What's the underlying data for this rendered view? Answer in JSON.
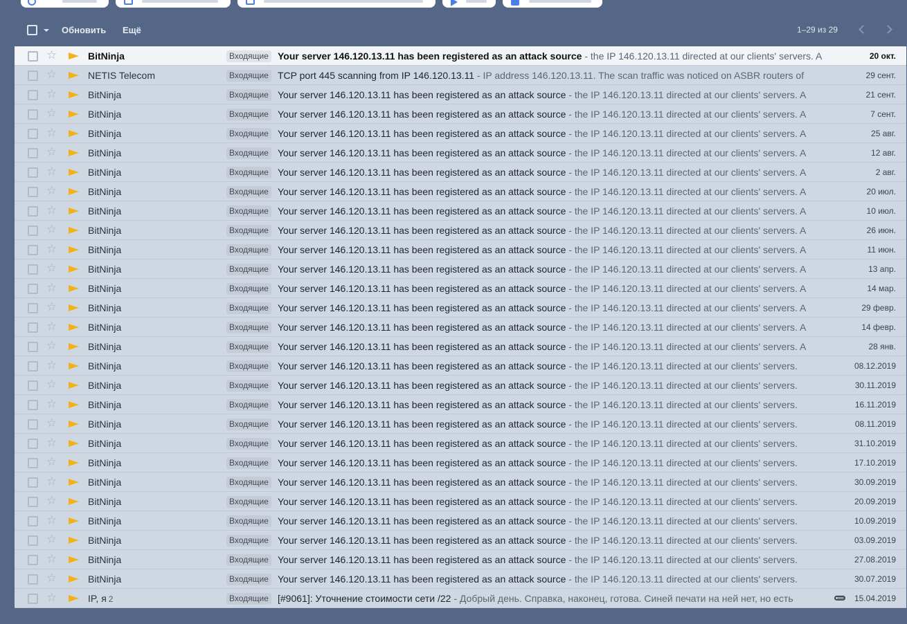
{
  "toolbar": {
    "refresh_label": "Обновить",
    "more_label": "Ещё",
    "pagination": "1–29 из 29"
  },
  "label_default": "Входящие",
  "emails": [
    {
      "sender": "BitNinja",
      "count": "",
      "label": "Входящие",
      "subject": "Your server 146.120.13.11 has been registered as an attack source",
      "snippet": " - the IP 146.120.13.11 directed at our clients' servers. A",
      "date": "20 окт.",
      "unread": true,
      "attachment": false
    },
    {
      "sender": "NETIS Telecom",
      "count": "",
      "label": "Входящие",
      "subject": "TCP port 445 scanning from IP 146.120.13.11",
      "snippet": " - IP address 146.120.13.11. The scan traffic was noticed on ASBR routers of",
      "date": "29 сент.",
      "unread": false,
      "attachment": false
    },
    {
      "sender": "BitNinja",
      "count": "",
      "label": "Входящие",
      "subject": "Your server 146.120.13.11 has been registered as an attack source",
      "snippet": " - the IP 146.120.13.11 directed at our clients' servers. A",
      "date": "21 сент.",
      "unread": false,
      "attachment": false
    },
    {
      "sender": "BitNinja",
      "count": "",
      "label": "Входящие",
      "subject": "Your server 146.120.13.11 has been registered as an attack source",
      "snippet": " - the IP 146.120.13.11 directed at our clients' servers. A",
      "date": "7 сент.",
      "unread": false,
      "attachment": false
    },
    {
      "sender": "BitNinja",
      "count": "",
      "label": "Входящие",
      "subject": "Your server 146.120.13.11 has been registered as an attack source",
      "snippet": " - the IP 146.120.13.11 directed at our clients' servers. A",
      "date": "25 авг.",
      "unread": false,
      "attachment": false
    },
    {
      "sender": "BitNinja",
      "count": "",
      "label": "Входящие",
      "subject": "Your server 146.120.13.11 has been registered as an attack source",
      "snippet": " - the IP 146.120.13.11 directed at our clients' servers. A",
      "date": "12 авг.",
      "unread": false,
      "attachment": false
    },
    {
      "sender": "BitNinja",
      "count": "",
      "label": "Входящие",
      "subject": "Your server 146.120.13.11 has been registered as an attack source",
      "snippet": " - the IP 146.120.13.11 directed at our clients' servers. A",
      "date": "2 авг.",
      "unread": false,
      "attachment": false
    },
    {
      "sender": "BitNinja",
      "count": "",
      "label": "Входящие",
      "subject": "Your server 146.120.13.11 has been registered as an attack source",
      "snippet": " - the IP 146.120.13.11 directed at our clients' servers. A",
      "date": "20 июл.",
      "unread": false,
      "attachment": false
    },
    {
      "sender": "BitNinja",
      "count": "",
      "label": "Входящие",
      "subject": "Your server 146.120.13.11 has been registered as an attack source",
      "snippet": " - the IP 146.120.13.11 directed at our clients' servers. A",
      "date": "10 июл.",
      "unread": false,
      "attachment": false
    },
    {
      "sender": "BitNinja",
      "count": "",
      "label": "Входящие",
      "subject": "Your server 146.120.13.11 has been registered as an attack source",
      "snippet": " - the IP 146.120.13.11 directed at our clients' servers. A",
      "date": "26 июн.",
      "unread": false,
      "attachment": false
    },
    {
      "sender": "BitNinja",
      "count": "",
      "label": "Входящие",
      "subject": "Your server 146.120.13.11 has been registered as an attack source",
      "snippet": " - the IP 146.120.13.11 directed at our clients' servers. A",
      "date": "11 июн.",
      "unread": false,
      "attachment": false
    },
    {
      "sender": "BitNinja",
      "count": "",
      "label": "Входящие",
      "subject": "Your server 146.120.13.11 has been registered as an attack source",
      "snippet": " - the IP 146.120.13.11 directed at our clients' servers. A",
      "date": "13 апр.",
      "unread": false,
      "attachment": false
    },
    {
      "sender": "BitNinja",
      "count": "",
      "label": "Входящие",
      "subject": "Your server 146.120.13.11 has been registered as an attack source",
      "snippet": " - the IP 146.120.13.11 directed at our clients' servers. A",
      "date": "14 мар.",
      "unread": false,
      "attachment": false
    },
    {
      "sender": "BitNinja",
      "count": "",
      "label": "Входящие",
      "subject": "Your server 146.120.13.11 has been registered as an attack source",
      "snippet": " - the IP 146.120.13.11 directed at our clients' servers. A",
      "date": "29 февр.",
      "unread": false,
      "attachment": false
    },
    {
      "sender": "BitNinja",
      "count": "",
      "label": "Входящие",
      "subject": "Your server 146.120.13.11 has been registered as an attack source",
      "snippet": " - the IP 146.120.13.11 directed at our clients' servers. A",
      "date": "14 февр.",
      "unread": false,
      "attachment": false
    },
    {
      "sender": "BitNinja",
      "count": "",
      "label": "Входящие",
      "subject": "Your server 146.120.13.11 has been registered as an attack source",
      "snippet": " - the IP 146.120.13.11 directed at our clients' servers. A",
      "date": "28 янв.",
      "unread": false,
      "attachment": false
    },
    {
      "sender": "BitNinja",
      "count": "",
      "label": "Входящие",
      "subject": "Your server 146.120.13.11 has been registered as an attack source",
      "snippet": " - the IP 146.120.13.11 directed at our clients' servers.",
      "date": "08.12.2019",
      "unread": false,
      "attachment": false
    },
    {
      "sender": "BitNinja",
      "count": "",
      "label": "Входящие",
      "subject": "Your server 146.120.13.11 has been registered as an attack source",
      "snippet": " - the IP 146.120.13.11 directed at our clients' servers.",
      "date": "30.11.2019",
      "unread": false,
      "attachment": false
    },
    {
      "sender": "BitNinja",
      "count": "",
      "label": "Входящие",
      "subject": "Your server 146.120.13.11 has been registered as an attack source",
      "snippet": " - the IP 146.120.13.11 directed at our clients' servers.",
      "date": "16.11.2019",
      "unread": false,
      "attachment": false
    },
    {
      "sender": "BitNinja",
      "count": "",
      "label": "Входящие",
      "subject": "Your server 146.120.13.11 has been registered as an attack source",
      "snippet": " - the IP 146.120.13.11 directed at our clients' servers.",
      "date": "08.11.2019",
      "unread": false,
      "attachment": false
    },
    {
      "sender": "BitNinja",
      "count": "",
      "label": "Входящие",
      "subject": "Your server 146.120.13.11 has been registered as an attack source",
      "snippet": " - the IP 146.120.13.11 directed at our clients' servers.",
      "date": "31.10.2019",
      "unread": false,
      "attachment": false
    },
    {
      "sender": "BitNinja",
      "count": "",
      "label": "Входящие",
      "subject": "Your server 146.120.13.11 has been registered as an attack source",
      "snippet": " - the IP 146.120.13.11 directed at our clients' servers.",
      "date": "17.10.2019",
      "unread": false,
      "attachment": false
    },
    {
      "sender": "BitNinja",
      "count": "",
      "label": "Входящие",
      "subject": "Your server 146.120.13.11 has been registered as an attack source",
      "snippet": " - the IP 146.120.13.11 directed at our clients' servers.",
      "date": "30.09.2019",
      "unread": false,
      "attachment": false
    },
    {
      "sender": "BitNinja",
      "count": "",
      "label": "Входящие",
      "subject": "Your server 146.120.13.11 has been registered as an attack source",
      "snippet": " - the IP 146.120.13.11 directed at our clients' servers.",
      "date": "20.09.2019",
      "unread": false,
      "attachment": false
    },
    {
      "sender": "BitNinja",
      "count": "",
      "label": "Входящие",
      "subject": "Your server 146.120.13.11 has been registered as an attack source",
      "snippet": " - the IP 146.120.13.11 directed at our clients' servers.",
      "date": "10.09.2019",
      "unread": false,
      "attachment": false
    },
    {
      "sender": "BitNinja",
      "count": "",
      "label": "Входящие",
      "subject": "Your server 146.120.13.11 has been registered as an attack source",
      "snippet": " - the IP 146.120.13.11 directed at our clients' servers.",
      "date": "03.09.2019",
      "unread": false,
      "attachment": false
    },
    {
      "sender": "BitNinja",
      "count": "",
      "label": "Входящие",
      "subject": "Your server 146.120.13.11 has been registered as an attack source",
      "snippet": " - the IP 146.120.13.11 directed at our clients' servers.",
      "date": "27.08.2019",
      "unread": false,
      "attachment": false
    },
    {
      "sender": "BitNinja",
      "count": "",
      "label": "Входящие",
      "subject": "Your server 146.120.13.11 has been registered as an attack source",
      "snippet": " - the IP 146.120.13.11 directed at our clients' servers.",
      "date": "30.07.2019",
      "unread": false,
      "attachment": false
    },
    {
      "sender": "IP, я",
      "count": "2",
      "label": "Входящие",
      "subject": "[#9061]: Уточнение стоимости сети /22",
      "snippet": " - Добрый день. Справка, наконец, готова. Синей печати на ней нет, но есть",
      "date": "15.04.2019",
      "unread": false,
      "attachment": true
    }
  ],
  "icons": {
    "checkbox": "checkbox-icon",
    "star": "star-icon",
    "importance": "importance-marker-icon",
    "attachment": "paperclip-icon"
  },
  "colors": {
    "background": "#546787",
    "importance": "#f3b21a",
    "list_bg": "#cfd7e2",
    "unread_row": "#f2f4f8"
  }
}
